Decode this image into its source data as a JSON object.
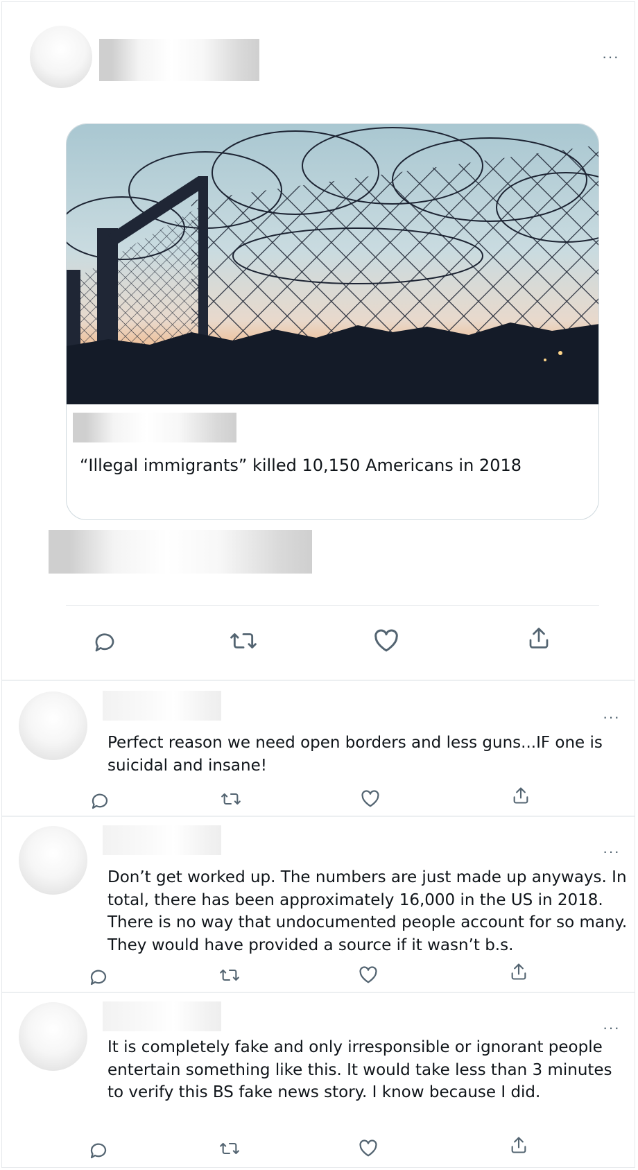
{
  "post": {
    "card_headline": "“Illegal immigrants” killed 10,150 Americans in 2018",
    "more_label": "···",
    "actions": [
      "reply-icon",
      "retweet-icon",
      "like-icon",
      "share-icon"
    ]
  },
  "replies": [
    {
      "text": "Perfect reason we need open borders and less guns...IF one is suicidal and insane!",
      "more_label": "···"
    },
    {
      "text": "Don’t get worked up. The numbers are just made up anyways. In total, there has been approximately 16,000 in the US in 2018. There is no way that undocumented people account for so many. They would have provided a source if it wasn’t b.s.",
      "more_label": "···"
    },
    {
      "text": "It is completely fake and only irresponsible or ignorant people entertain something like this. It would take less than 3 minutes to verify this BS fake news story. I know because I did.",
      "more_label": "···"
    }
  ],
  "colors": {
    "icon": "#536471",
    "text": "#0f1419",
    "border": "#cfd9de"
  }
}
